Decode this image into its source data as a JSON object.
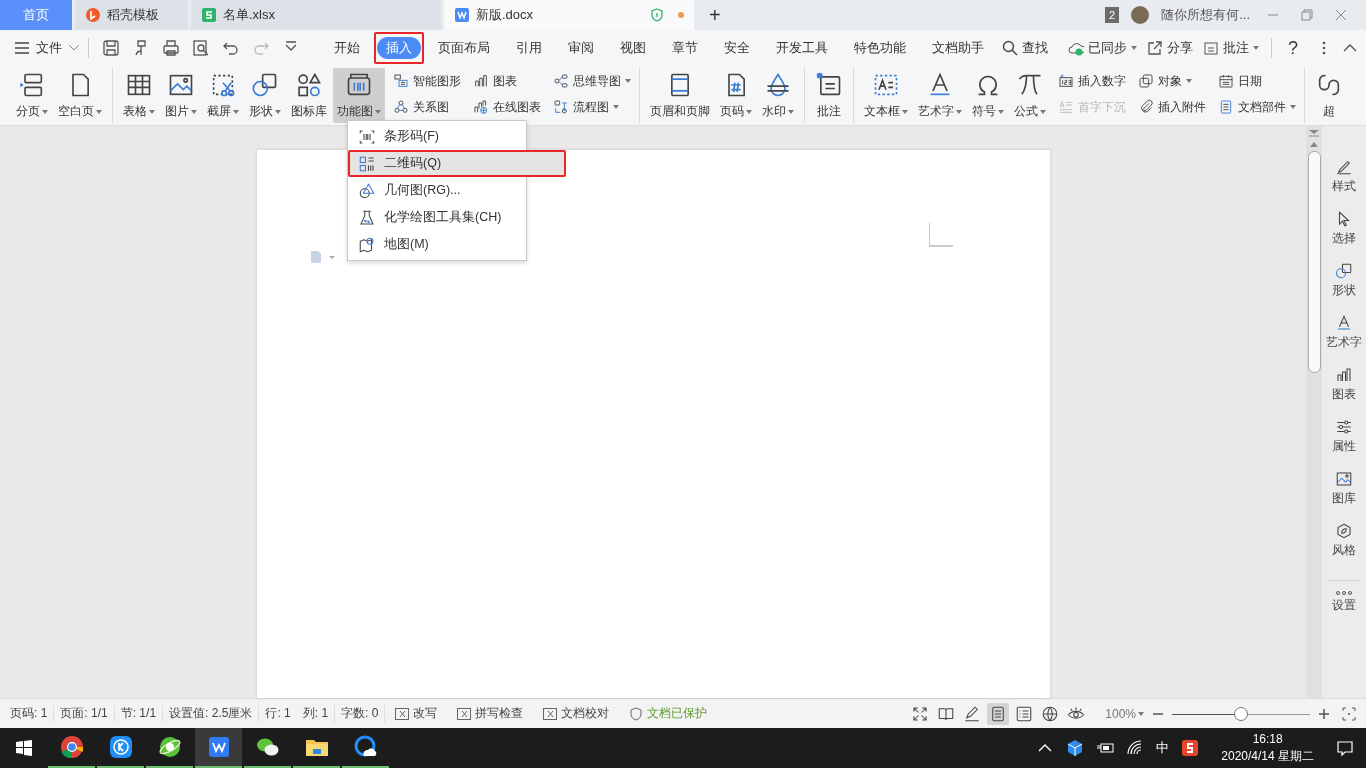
{
  "tabs": [
    {
      "label": "首页",
      "kind": "home",
      "selected": false,
      "modified": false
    },
    {
      "label": "稻壳模板",
      "kind": "docer",
      "selected": false,
      "modified": false
    },
    {
      "label": "名单.xlsx",
      "kind": "sheet",
      "selected": false,
      "modified": false
    },
    {
      "label": "新版.docx",
      "kind": "writer",
      "selected": true,
      "modified": true
    }
  ],
  "new_tab": "+",
  "window_count": "2",
  "user_name": "随你所想有何...",
  "menu": {
    "file": "文件",
    "tabs": [
      {
        "label": "开始",
        "selected": false,
        "annotated": false
      },
      {
        "label": "插入",
        "selected": true,
        "annotated": true
      },
      {
        "label": "页面布局",
        "selected": false,
        "annotated": false
      },
      {
        "label": "引用",
        "selected": false,
        "annotated": false
      },
      {
        "label": "审阅",
        "selected": false,
        "annotated": false
      },
      {
        "label": "视图",
        "selected": false,
        "annotated": false
      },
      {
        "label": "章节",
        "selected": false,
        "annotated": false
      },
      {
        "label": "安全",
        "selected": false,
        "annotated": false
      },
      {
        "label": "开发工具",
        "selected": false,
        "annotated": false
      },
      {
        "label": "特色功能",
        "selected": false,
        "annotated": false
      },
      {
        "label": "文档助手",
        "selected": false,
        "annotated": false
      }
    ],
    "search": "查找",
    "sync": "已同步",
    "share": "分享",
    "comment": "批注",
    "help": "?"
  },
  "ribbon": [
    {
      "buttons": [
        {
          "label": "分页",
          "dropdown": true,
          "pressed": false,
          "disabled": false
        },
        {
          "label": "空白页",
          "dropdown": true,
          "pressed": false,
          "disabled": false
        }
      ]
    },
    {
      "buttons": [
        {
          "label": "表格",
          "dropdown": true,
          "pressed": false,
          "disabled": false
        },
        {
          "label": "图片",
          "dropdown": true,
          "pressed": false,
          "disabled": false
        },
        {
          "label": "截屏",
          "dropdown": true,
          "pressed": false,
          "disabled": false
        },
        {
          "label": "形状",
          "dropdown": true,
          "pressed": false,
          "disabled": false
        },
        {
          "label": "图标库",
          "dropdown": false,
          "pressed": false,
          "disabled": false
        },
        {
          "label": "功能图",
          "dropdown": true,
          "pressed": true,
          "disabled": false
        }
      ],
      "compact": [
        {
          "label": "智能图形",
          "dropdown": false,
          "pressed": false,
          "disabled": false
        },
        {
          "label": "关系图",
          "dropdown": false,
          "pressed": false,
          "disabled": false
        },
        {
          "label": "图表",
          "dropdown": false,
          "pressed": false,
          "disabled": false
        },
        {
          "label": "在线图表",
          "dropdown": false,
          "pressed": false,
          "disabled": false
        },
        {
          "label": "思维导图",
          "dropdown": true,
          "pressed": false,
          "disabled": false
        },
        {
          "label": "流程图",
          "dropdown": true,
          "pressed": false,
          "disabled": false
        }
      ]
    },
    {
      "buttons": [
        {
          "label": "页眉和页脚",
          "dropdown": false,
          "pressed": false,
          "disabled": false
        },
        {
          "label": "页码",
          "dropdown": true,
          "pressed": false,
          "disabled": false
        },
        {
          "label": "水印",
          "dropdown": true,
          "pressed": false,
          "disabled": false
        }
      ]
    },
    {
      "buttons": [
        {
          "label": "批注",
          "dropdown": false,
          "pressed": false,
          "disabled": false
        }
      ]
    },
    {
      "buttons": [
        {
          "label": "文本框",
          "dropdown": true,
          "pressed": false,
          "disabled": false
        },
        {
          "label": "艺术字",
          "dropdown": true,
          "pressed": false,
          "disabled": false
        },
        {
          "label": "符号",
          "dropdown": true,
          "pressed": false,
          "disabled": false
        },
        {
          "label": "公式",
          "dropdown": true,
          "pressed": false,
          "disabled": false
        }
      ],
      "compact": [
        {
          "label": "插入数字",
          "dropdown": false,
          "pressed": false,
          "disabled": false
        },
        {
          "label": "首字下沉",
          "dropdown": false,
          "pressed": false,
          "disabled": true
        },
        {
          "label": "对象",
          "dropdown": true,
          "pressed": false,
          "disabled": false
        },
        {
          "label": "插入附件",
          "dropdown": false,
          "pressed": false,
          "disabled": false
        },
        {
          "label": "日期",
          "dropdown": false,
          "pressed": false,
          "disabled": false
        },
        {
          "label": "文档部件",
          "dropdown": true,
          "pressed": false,
          "disabled": false
        }
      ]
    },
    {
      "buttons": [
        {
          "label": "超",
          "dropdown": false,
          "pressed": false,
          "disabled": false
        }
      ]
    }
  ],
  "dropdown": {
    "items": [
      {
        "label": "条形码(F)",
        "selected": false,
        "annotated": false
      },
      {
        "label": "二维码(Q)",
        "selected": true,
        "annotated": true
      },
      {
        "label": "几何图(RG)...",
        "selected": false,
        "annotated": false
      },
      {
        "label": "化学绘图工具集(CH)",
        "selected": false,
        "annotated": false
      },
      {
        "label": "地图(M)",
        "selected": false,
        "annotated": false
      }
    ]
  },
  "sidebar": {
    "items": [
      {
        "label": "样式"
      },
      {
        "label": "选择"
      },
      {
        "label": "形状"
      },
      {
        "label": "艺术字"
      },
      {
        "label": "图表"
      },
      {
        "label": "属性"
      },
      {
        "label": "图库"
      },
      {
        "label": "风格"
      },
      {
        "label": "设置"
      }
    ]
  },
  "status_bar": {
    "fields": [
      "页码: 1",
      "页面: 1/1",
      "节: 1/1",
      "设置值: 2.5厘米",
      "行: 1",
      "列: 1",
      "字数: 0"
    ],
    "toggles": [
      {
        "label": "改写"
      },
      {
        "label": "拼写检查"
      },
      {
        "label": "文档校对"
      }
    ],
    "protection": "文档已保护",
    "views": [
      {
        "selected": false
      },
      {
        "selected": false
      },
      {
        "selected": false
      },
      {
        "selected": true
      },
      {
        "selected": false
      },
      {
        "selected": false
      },
      {
        "selected": false
      }
    ],
    "zoom": "100%",
    "zoom_slider": {
      "level": 0.5
    }
  },
  "taskbar": {
    "apps": [
      {
        "kind": "chrome",
        "active": false
      },
      {
        "kind": "kapp",
        "active": false
      },
      {
        "kind": "ebrowser",
        "active": false
      },
      {
        "kind": "wps",
        "active": true
      },
      {
        "kind": "wechat",
        "active": false
      },
      {
        "kind": "explorer",
        "active": false
      },
      {
        "kind": "cloud",
        "active": false
      }
    ],
    "ime": "中",
    "time": "16:18",
    "date": "2020/4/14 星期二"
  }
}
